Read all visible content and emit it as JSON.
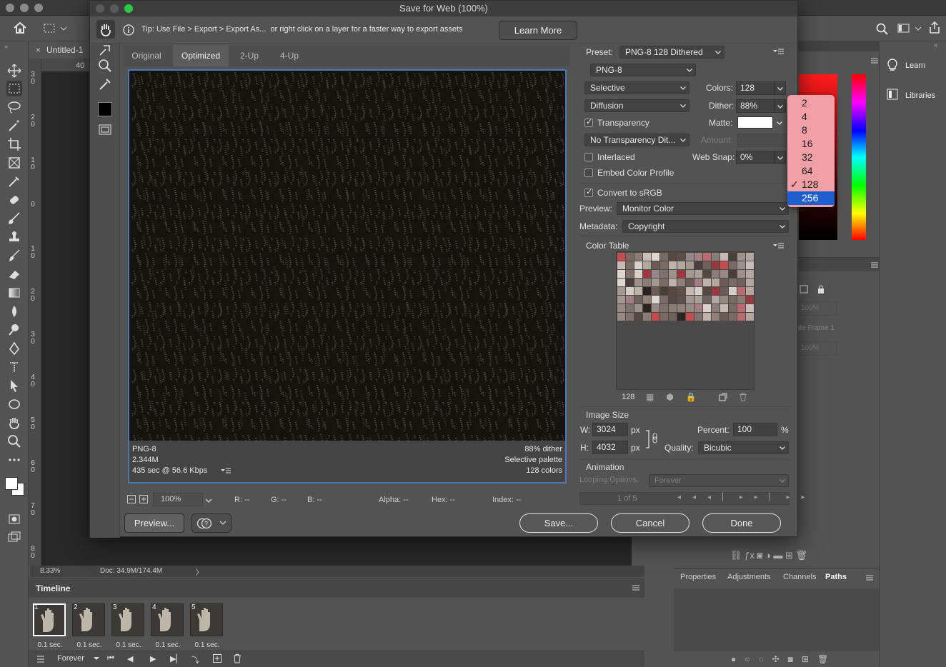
{
  "app": {
    "doc_tab_label": "Untitled-1",
    "ruler_h_number": "40",
    "ruler_v_numbers": [
      "3\n0",
      "2\n0",
      "1\n0",
      "0",
      "1\n0",
      "2\n0",
      "3\n0",
      "4\n0",
      "5\n0",
      "6\n0",
      "7\n0",
      "8\n0"
    ],
    "status_zoom": "8.33%",
    "status_doc": "Doc: 34.9M/174.4M"
  },
  "timeline": {
    "title": "Timeline",
    "frames": [
      {
        "num": "1",
        "dur": "0.1 sec."
      },
      {
        "num": "2",
        "dur": "0.1 sec."
      },
      {
        "num": "3",
        "dur": "0.1 sec."
      },
      {
        "num": "4",
        "dur": "0.1 sec."
      },
      {
        "num": "5",
        "dur": "0.1 sec."
      }
    ],
    "loop": "Forever"
  },
  "right_panels": {
    "learn": "Learn",
    "libraries": "Libraries",
    "layer_opacity": "100%",
    "layer_fill": "100%",
    "layer_label": "ate Frame 1",
    "tabs": [
      "Properties",
      "Adjustments",
      "Channels",
      "Paths"
    ],
    "active_tab": "Paths"
  },
  "dialog": {
    "title": "Save for Web (100%)",
    "tip": "Tip: Use File > Export > Export As...  or right click on a layer for a faster way to export assets",
    "learn_more": "Learn More",
    "tabs": [
      "Original",
      "Optimized",
      "2-Up",
      "4-Up"
    ],
    "active_tab": "Optimized",
    "preview_info": {
      "format": "PNG-8",
      "size": "2.344M",
      "time": "435 sec @ 56.6 Kbps",
      "dither": "88% dither",
      "palette": "Selective palette",
      "colors": "128 colors"
    },
    "zoom": {
      "level": "100%",
      "r": "R: --",
      "g": "G: --",
      "b": "B: --",
      "alpha": "Alpha: --",
      "hex": "Hex: --",
      "index": "Index: --"
    },
    "buttons": {
      "preview": "Preview...",
      "save": "Save...",
      "cancel": "Cancel",
      "done": "Done"
    },
    "settings": {
      "preset_label": "Preset:",
      "preset_value": "PNG-8 128 Dithered",
      "format": "PNG-8",
      "reduction": "Selective",
      "dither_algo": "Diffusion",
      "colors_label": "Colors:",
      "colors_value": "128",
      "dither_label": "Dither:",
      "dither_value": "88%",
      "transparency": "Transparency",
      "matte_label": "Matte:",
      "transparency_dither": "No Transparency Dit...",
      "amount_label": "Amount:",
      "interlaced": "Interlaced",
      "websnap_label": "Web Snap:",
      "websnap_value": "0%",
      "embed_profile": "Embed Color Profile",
      "convert_srgb": "Convert to sRGB",
      "preview_label": "Preview:",
      "preview_value": "Monitor Color",
      "metadata_label": "Metadata:",
      "metadata_value": "Copyright"
    },
    "color_table": {
      "title": "Color Table",
      "count": "128"
    },
    "image_size": {
      "title": "Image Size",
      "w_label": "W:",
      "w_value": "3024",
      "h_label": "H:",
      "h_value": "4032",
      "unit": "px",
      "percent_label": "Percent:",
      "percent_value": "100",
      "percent_unit": "%",
      "quality_label": "Quality:",
      "quality_value": "Bicubic"
    },
    "animation": {
      "title": "Animation",
      "looping_label": "Looping Options:",
      "looping_value": "Forever",
      "frame_counter": "1 of 5"
    }
  },
  "colors_dropdown": {
    "options": [
      "2",
      "4",
      "8",
      "16",
      "32",
      "64",
      "128",
      "256"
    ],
    "checked": "128",
    "highlighted": "256"
  }
}
